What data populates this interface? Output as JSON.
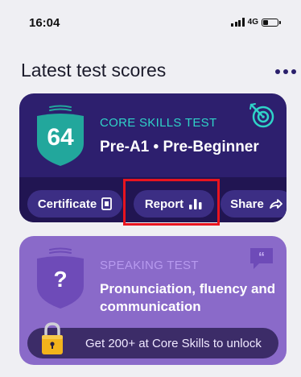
{
  "status_bar": {
    "time": "16:04",
    "network": "4G",
    "battery_level": 0.35
  },
  "header": {
    "title": "Latest test scores",
    "more_icon": "more-horizontal-icon"
  },
  "core_card": {
    "score": "64",
    "test_name": "CORE SKILLS TEST",
    "level": "Pre-A1 • Pre-Beginner",
    "badge_icon": "target-icon",
    "buttons": {
      "certificate_label": "Certificate",
      "certificate_icon": "certificate-icon",
      "report_label": "Report",
      "report_icon": "bar-chart-icon",
      "share_label": "Share",
      "share_icon": "share-arrow-icon"
    }
  },
  "speaking_card": {
    "shield_symbol": "?",
    "test_name": "SPEAKING TEST",
    "description": "Pronunciation, fluency and communication",
    "badge_icon": "quote-bubble-icon",
    "lock_message": "Get 200+ at Core Skills to unlock",
    "lock_icon": "padlock-icon"
  },
  "colors": {
    "core_card_bg": "#2d1f6e",
    "core_shield": "#22a79c",
    "speaking_card_bg": "#8a6ac9",
    "highlight": "#e8141f",
    "accent_teal": "#2fd3c8"
  }
}
